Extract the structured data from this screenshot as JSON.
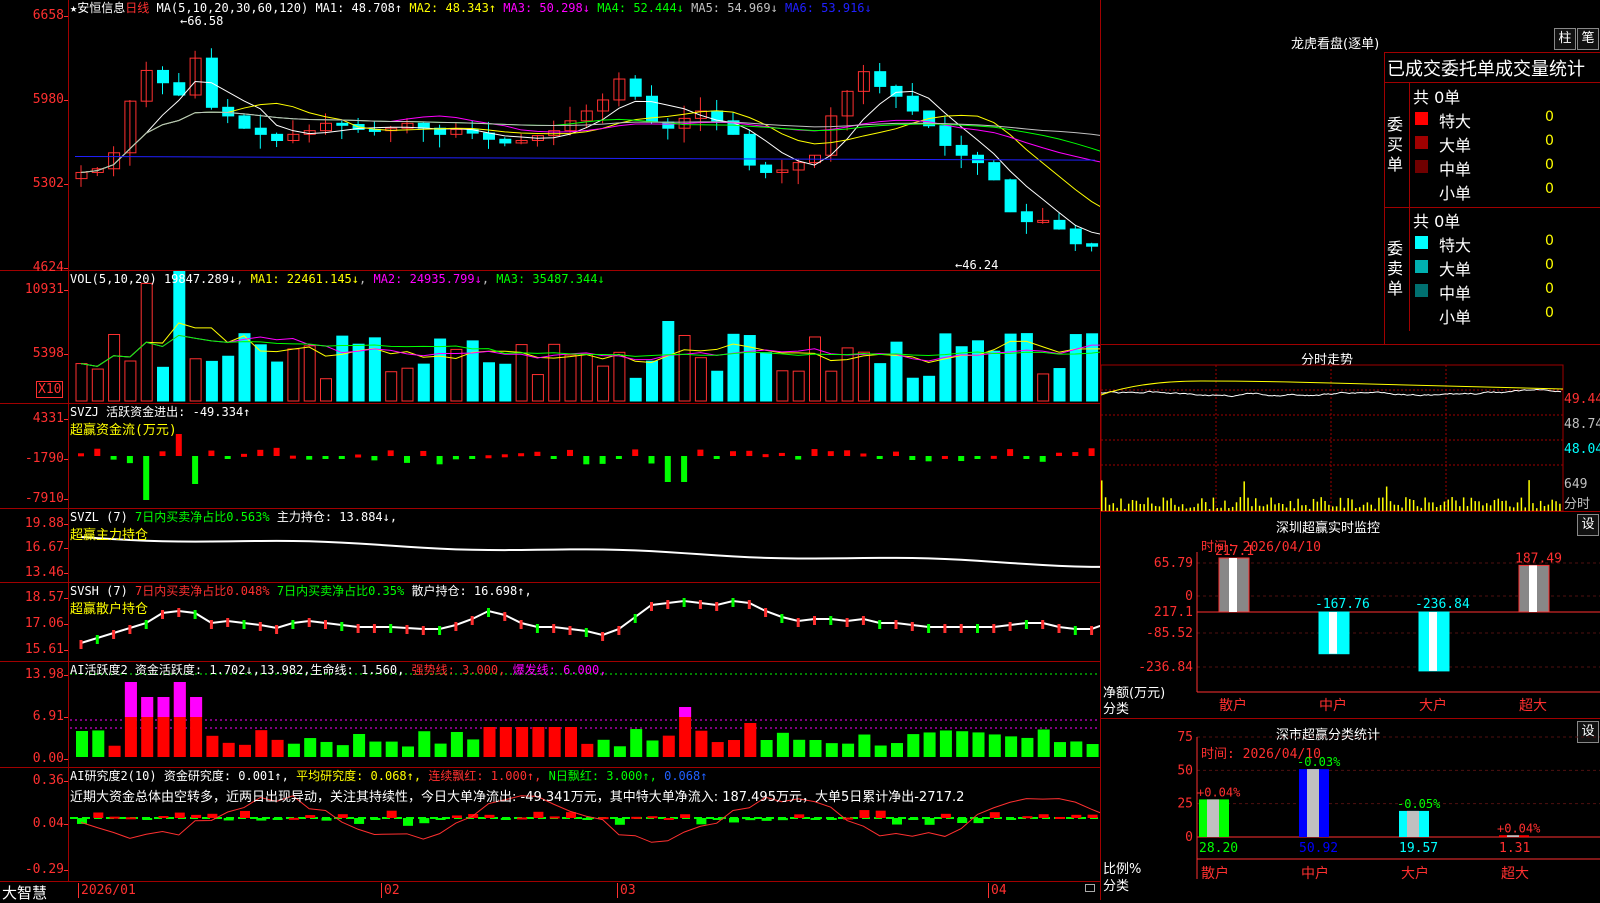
{
  "stock": {
    "name_line": "★安恒信息",
    "period": "日线"
  },
  "main": {
    "ma_label": "MA(5,10,20,30,60,120)",
    "ma": [
      {
        "k": "MA1:",
        "v": "48.708↑",
        "c": "#ffffff"
      },
      {
        "k": "MA2:",
        "v": "48.343↑",
        "c": "#ffff00"
      },
      {
        "k": "MA3:",
        "v": "50.298↓",
        "c": "#ff00ff"
      },
      {
        "k": "MA4:",
        "v": "52.444↓",
        "c": "#00ff00"
      },
      {
        "k": "MA5:",
        "v": "54.969↓",
        "c": "#c0c0c0"
      },
      {
        "k": "MA6:",
        "v": "53.916↓",
        "c": "#2020ff"
      }
    ],
    "ticks": [
      "6658",
      "5980",
      "5302",
      "4624"
    ],
    "high_label": "66.58",
    "low_label": "46.24"
  },
  "vol": {
    "label": "VOL(5,10,20)",
    "value": "19847.289↓",
    "ma1": "MA1: 22461.145↓",
    "ma2": "MA2: 24935.799↓",
    "ma3": "MA3: 35487.344↓",
    "ticks": [
      "10931",
      "5398"
    ],
    "unit": "X10"
  },
  "svzj": {
    "label": "SVZJ",
    "title": "活跃资金进出: -49.334↑",
    "sub": "超赢资金流(万元)",
    "ticks": [
      "4331",
      "-1790",
      "-7910"
    ]
  },
  "svzl": {
    "label": "SVZL (7)",
    "t1": "7日内买卖净占比0.563%",
    "t2": "主力持仓: 13.884↓,",
    "sub": "超赢主力持仓",
    "ticks": [
      "19.88",
      "16.67",
      "13.46"
    ]
  },
  "svsh": {
    "label": "SVSH (7)",
    "t1": "7日内买卖净占比0.048%",
    "t2": "7日内买卖净占比0.35%",
    "t3": "散户持仓: 16.698↑,",
    "sub": "超赢散户持仓",
    "ticks": [
      "18.57",
      "17.06",
      "15.61"
    ]
  },
  "ai1": {
    "label": "AI活跃度2",
    "t1": "资金活跃度: 1.702↓,",
    "t2": "13.982,",
    "t3": "生命线: 1.560,",
    "t4": "强势线: 3.000,",
    "t5": "爆发线: 6.000,",
    "ticks": [
      "13.98",
      "6.91",
      "0.00"
    ]
  },
  "ai2": {
    "label": "AI研究度2(10)",
    "t1": "资金研究度: 0.001↑,",
    "t2": "平均研究度: 0.068↑,",
    "t3": "连续飘红: 1.000↑,",
    "t4": "N日飘红: 3.000↑,",
    "t5": "0.068↑",
    "comment": "近期大资金总体由空转多，近两日出现异动，关注其持续性，今日大单净流出: -49.341万元，其中特大单净流入: 187.495万元，大单5日累计净出-2717.2",
    "ticks": [
      "0.36",
      "0.04",
      "-0.29"
    ]
  },
  "dates": {
    "brand": "大智慧",
    "labels": [
      "2026/01",
      "02",
      "03",
      "04"
    ]
  },
  "lh": {
    "title": "龙虎看盘(逐单)",
    "btn1": "柱",
    "btn2": "笔",
    "header": "已成交委托单成交量统计",
    "buy_side": "委买单",
    "sell_side": "委卖单",
    "buy_total": "共 0单",
    "sell_total": "共 0单",
    "buy": [
      {
        "label": "特大",
        "v": "0",
        "p": "0%",
        "color": "#ff0000"
      },
      {
        "label": "大单",
        "v": "0",
        "p": "0%",
        "color": "#a00000"
      },
      {
        "label": "中单",
        "v": "0",
        "p": "0%",
        "color": "#700000"
      },
      {
        "label": "小单",
        "v": "0",
        "p": "0%",
        "color": "#000000"
      }
    ],
    "sell": [
      {
        "label": "特大",
        "v": "0",
        "p": "0%",
        "color": "#00ffff"
      },
      {
        "label": "大单",
        "v": "0",
        "p": "0%",
        "color": "#00b0b0"
      },
      {
        "label": "中单",
        "v": "0",
        "p": "0%",
        "color": "#007070"
      },
      {
        "label": "小单",
        "v": "0",
        "p": "0%",
        "color": "#000000"
      }
    ]
  },
  "fs": {
    "title": "分时走势",
    "ticks": [
      "49.44",
      "48.74",
      "48.04"
    ],
    "vol_tick": "649",
    "unit": "分时"
  },
  "sz": {
    "title": "深圳超赢实时监控",
    "btn": "设",
    "time": "时间: 2026/04/10",
    "ylabel": "净额(万元)",
    "xlabel": "分类",
    "ticks": [
      "217.1",
      "65.79",
      "0",
      "-85.52",
      "-236.84"
    ],
    "cats": [
      "散户",
      "中户",
      "大户",
      "超大"
    ],
    "values": [
      217.1,
      -167.76,
      -236.84,
      187.49
    ],
    "labels": [
      "217.1",
      "-167.76",
      "-236.84",
      "187.49"
    ]
  },
  "sc": {
    "title": "深市超赢分类统计",
    "btn": "设",
    "time": "时间: 2026/04/10",
    "ylabel": "比例%",
    "xlabel": "分类",
    "ticks": [
      "75",
      "50",
      "25",
      "0"
    ],
    "cats": [
      "散户",
      "中户",
      "大户",
      "超大"
    ],
    "values": [
      28.2,
      50.92,
      19.57,
      1.31
    ],
    "vals_text": [
      "28.20",
      "50.92",
      "19.57",
      "1.31"
    ],
    "chg": [
      "+0.04%",
      "-0.03%",
      "-0.05%",
      "+0.04%"
    ]
  }
}
